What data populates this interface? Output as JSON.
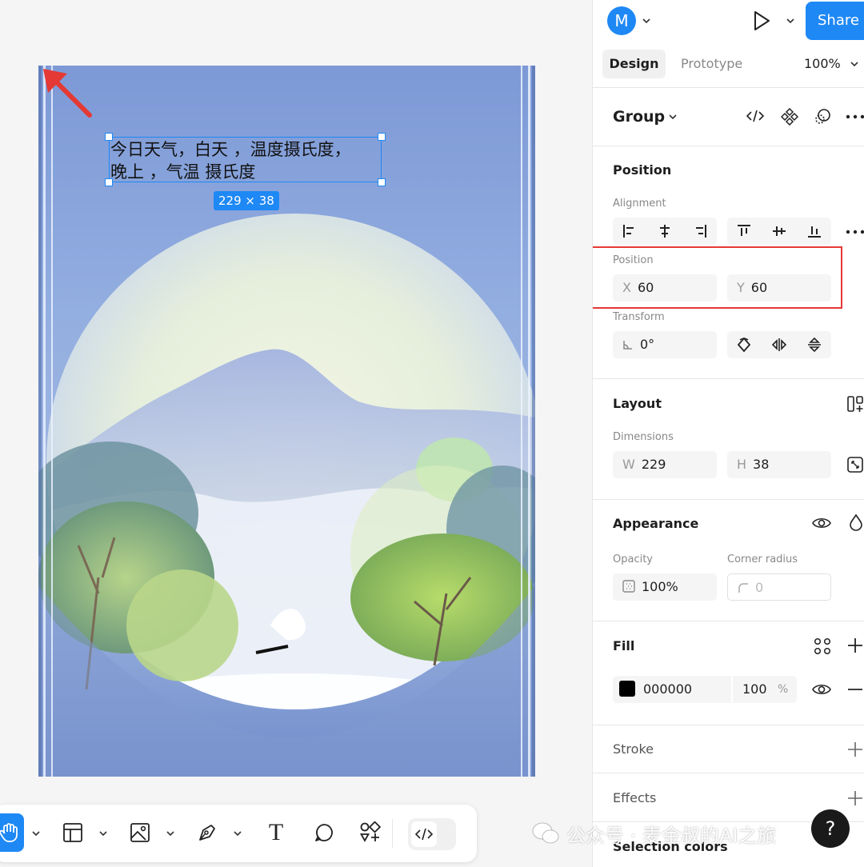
{
  "canvas": {
    "text_layer": {
      "content": "今日天气，白天 ，温度摄氏度，\n晚上 ，气温 摄氏度"
    },
    "dimension_badge": "229 × 38"
  },
  "toolbar": {
    "tools": [
      "hand-tool",
      "frame-tool",
      "image-tool",
      "pen-tool",
      "text-tool",
      "comment-tool",
      "components-tool",
      "dev-mode-toggle"
    ],
    "text_tool_glyph": "T"
  },
  "header": {
    "avatar_initial": "M",
    "share_label": "Share",
    "tabs": [
      {
        "label": "Design",
        "active": true
      },
      {
        "label": "Prototype",
        "active": false
      }
    ],
    "zoom": "100%"
  },
  "panel": {
    "layer_name": "Group",
    "position_section": {
      "title": "Position",
      "alignment_label": "Alignment",
      "position_label": "Position",
      "x_prefix": "X",
      "x_value": "60",
      "y_prefix": "Y",
      "y_value": "60",
      "transform_label": "Transform",
      "rotation_value": "0°"
    },
    "layout_section": {
      "title": "Layout",
      "dimensions_label": "Dimensions",
      "w_prefix": "W",
      "w_value": "229",
      "h_prefix": "H",
      "h_value": "38"
    },
    "appearance_section": {
      "title": "Appearance",
      "opacity_label": "Opacity",
      "opacity_value": "100%",
      "corner_radius_label": "Corner radius",
      "corner_radius_value": "0"
    },
    "fill_section": {
      "title": "Fill",
      "color_hex": "000000",
      "opacity": "100",
      "percent": "%",
      "swatch_color": "#000000"
    },
    "stroke_section": {
      "title": "Stroke"
    },
    "effects_section": {
      "title": "Effects"
    },
    "selection_colors_section": {
      "title": "Selection colors"
    }
  },
  "watermark": {
    "text": "公众号 · 麦金叔的AI之旅"
  },
  "help_label": "?",
  "colors": {
    "accent": "#1e88f5",
    "annotation_red": "#e53935"
  }
}
